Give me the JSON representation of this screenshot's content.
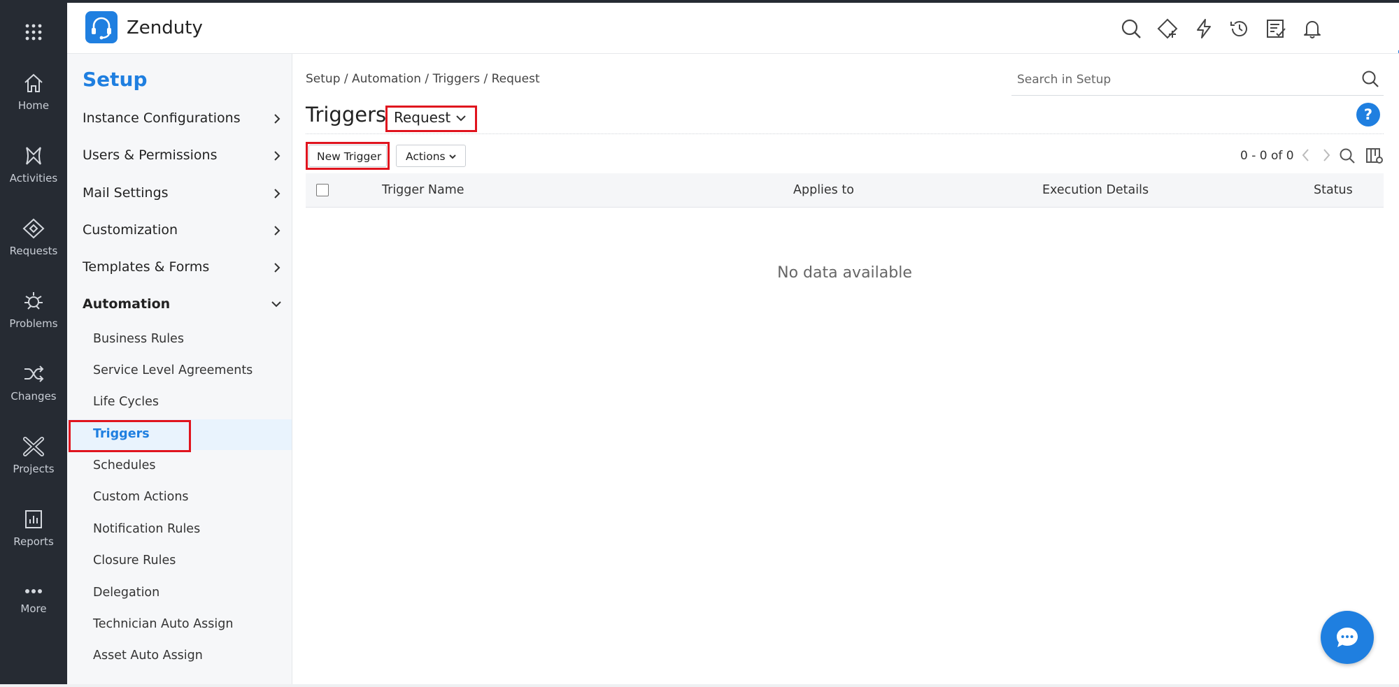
{
  "app": {
    "brand": "Zenduty"
  },
  "rail": {
    "items": [
      {
        "label": "Home",
        "icon": "home-icon"
      },
      {
        "label": "Activities",
        "icon": "activities-icon"
      },
      {
        "label": "Requests",
        "icon": "requests-icon"
      },
      {
        "label": "Problems",
        "icon": "problems-icon"
      },
      {
        "label": "Changes",
        "icon": "changes-icon"
      },
      {
        "label": "Projects",
        "icon": "projects-icon"
      },
      {
        "label": "Reports",
        "icon": "reports-icon"
      },
      {
        "label": "More",
        "icon": "more-icon"
      }
    ]
  },
  "header_icons": [
    "search-icon",
    "ticket-add-icon",
    "quick-actions-icon",
    "history-icon",
    "tasks-icon",
    "notifications-icon",
    "settings-icon",
    "avatar"
  ],
  "setup": {
    "title": "Setup",
    "sections": [
      {
        "label": "Instance Configurations"
      },
      {
        "label": "Users & Permissions"
      },
      {
        "label": "Mail Settings"
      },
      {
        "label": "Customization"
      },
      {
        "label": "Templates & Forms"
      },
      {
        "label": "Automation"
      }
    ],
    "automation_items": [
      {
        "label": "Business Rules"
      },
      {
        "label": "Service Level Agreements"
      },
      {
        "label": "Life Cycles"
      },
      {
        "label": "Triggers",
        "active": true
      },
      {
        "label": "Schedules"
      },
      {
        "label": "Custom Actions"
      },
      {
        "label": "Notification Rules"
      },
      {
        "label": "Closure Rules"
      },
      {
        "label": "Delegation"
      },
      {
        "label": "Technician Auto Assign"
      },
      {
        "label": "Asset Auto Assign"
      }
    ]
  },
  "main": {
    "breadcrumb": "Setup / Automation / Triggers / Request",
    "search_placeholder": "Search in Setup",
    "title": "Triggers",
    "module_selected": "Request",
    "help": "?",
    "new_button": "New Trigger",
    "actions_button": "Actions",
    "pager": "0 - 0 of 0",
    "columns": [
      "Trigger Name",
      "Applies to",
      "Execution Details",
      "Status"
    ],
    "empty_message": "No data available"
  },
  "colors": {
    "accent": "#1f7fe0",
    "rail": "#262b33",
    "highlight": "#e0141e"
  }
}
